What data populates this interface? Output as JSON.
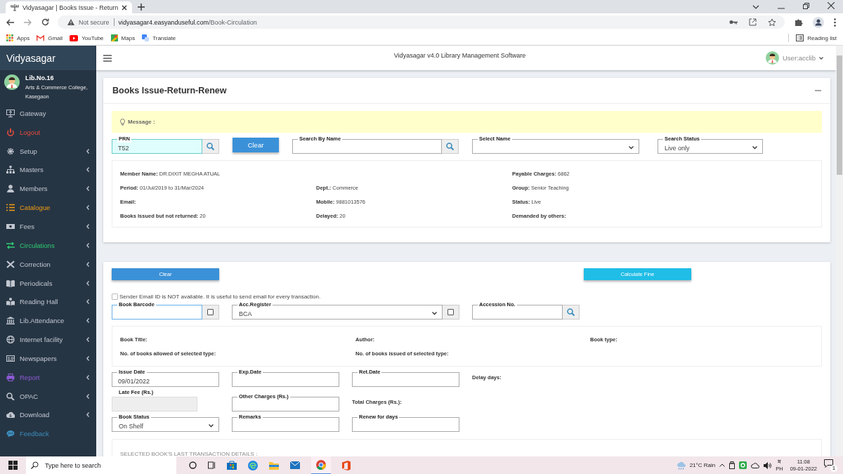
{
  "browser": {
    "tab_title": "Vidyasagar | Books Issue - Return",
    "security": "Not secure",
    "url_host": "vidyasagar4.easyanduseful.com",
    "url_path": "/Book-Circulation",
    "bookmarks": [
      "Apps",
      "Gmail",
      "YouTube",
      "Maps",
      "Translate"
    ],
    "reading_list": "Reading list"
  },
  "app": {
    "brand": "Vidyasagar",
    "lib_no": "Lib.No.16",
    "college": "Arts & Commerce College, Kasegaon",
    "header_title": "Vidyasagar v4.0 Library Management Software",
    "user": "User:acclib",
    "menu": [
      {
        "label": "Gateway",
        "color": "#c2c7d0",
        "has_submenu": false
      },
      {
        "label": "Logout",
        "color": "#e74c3c",
        "has_submenu": false
      },
      {
        "label": "Setup",
        "color": "#c2c7d0",
        "has_submenu": true
      },
      {
        "label": "Masters",
        "color": "#c2c7d0",
        "has_submenu": true
      },
      {
        "label": "Members",
        "color": "#c2c7d0",
        "has_submenu": true
      },
      {
        "label": "Catalogue",
        "color": "#f39c12",
        "has_submenu": true
      },
      {
        "label": "Fees",
        "color": "#c2c7d0",
        "has_submenu": true
      },
      {
        "label": "Circulations",
        "color": "#2ecc71",
        "has_submenu": true
      },
      {
        "label": "Correction",
        "color": "#c2c7d0",
        "has_submenu": true
      },
      {
        "label": "Periodicals",
        "color": "#c2c7d0",
        "has_submenu": true
      },
      {
        "label": "Reading Hall",
        "color": "#c2c7d0",
        "has_submenu": true
      },
      {
        "label": "Lib.Attendance",
        "color": "#c2c7d0",
        "has_submenu": true
      },
      {
        "label": "Internet facility",
        "color": "#c2c7d0",
        "has_submenu": true
      },
      {
        "label": "Newspapers",
        "color": "#c2c7d0",
        "has_submenu": true
      },
      {
        "label": "Report",
        "color": "#8e5bd6",
        "has_submenu": true
      },
      {
        "label": "OPAC",
        "color": "#c2c7d0",
        "has_submenu": true
      },
      {
        "label": "Download",
        "color": "#c2c7d0",
        "has_submenu": true
      },
      {
        "label": "Feedback",
        "color": "#3c8dbc",
        "has_submenu": false
      }
    ]
  },
  "issue_panel": {
    "title": "Books Issue-Return-Renew",
    "message_label": "Message :",
    "prn": {
      "label": "PRN",
      "value": "T52"
    },
    "clear_button": "Clear",
    "search_by_name": {
      "label": "Search By Name"
    },
    "select_name": {
      "label": "Select Name"
    },
    "search_status": {
      "label": "Search Status",
      "value": "Live only"
    },
    "member_rows": [
      [
        {
          "label": "Member Name:",
          "value": "DR.DIXIT MEGHA ATUAL"
        },
        null,
        {
          "label": "Payable Charges:",
          "value": "6862"
        }
      ],
      [
        {
          "label": "Period:",
          "value": "01/Jul/2019 to  31/Mar/2024"
        },
        {
          "label": "Dept.:",
          "value": "Commerce"
        },
        {
          "label": "Group:",
          "value": "Senior Teaching"
        }
      ],
      [
        {
          "label": "Email:"
        },
        {
          "label": "Mobile:",
          "value": "9881013576"
        },
        {
          "label": "Status:",
          "value": "Live"
        }
      ],
      [
        {
          "label": "Books Issued but not returned:",
          "value": "20"
        },
        {
          "label": "Delayed:",
          "value": "20"
        },
        {
          "label": "Demanded by others:"
        }
      ]
    ]
  },
  "book_panel": {
    "clear_button": "Clear",
    "calculate_button": "Calculate Fine",
    "email_notice": {
      "text": "Sender Email ID is NOT available. It is useful to send email for every transaction.",
      "checked": false
    },
    "book_barcode": {
      "label": "Book Barcode",
      "checked": false
    },
    "acc_register": {
      "label": "Acc.Register",
      "value": "BCA",
      "checked": false
    },
    "accession_no": {
      "label": "Accession No."
    },
    "book_rows": [
      [
        {
          "label": "Book Title:"
        },
        {
          "label": "Author:"
        },
        {
          "label": "Book type:"
        }
      ],
      [
        {
          "label": "No. of books allowed of selected type:"
        },
        {
          "label": "No. of books issued of selected type:"
        },
        null
      ]
    ],
    "charges_rows": [
      [
        {
          "kind": "input",
          "label": "Issue Date",
          "value": "09/01/2022",
          "disabled": false
        },
        {
          "kind": "input",
          "label": "Exp.Date",
          "disabled": false
        },
        {
          "kind": "input",
          "label": "Ret.Date",
          "disabled": false
        },
        {
          "kind": "text",
          "label": "Delay days:"
        }
      ],
      [
        {
          "kind": "input",
          "label": "Late Fee (Rs.)",
          "disabled": true
        },
        {
          "kind": "input",
          "label": "Other Charges (Rs.)",
          "disabled": false
        },
        {
          "kind": "text",
          "label": "Total Charges (Rs.):"
        }
      ],
      [
        {
          "kind": "select",
          "label": "Book Status",
          "value": "On Shelf",
          "disabled": false
        },
        {
          "kind": "input",
          "label": "Remarks",
          "disabled": false
        },
        {
          "kind": "input",
          "label": "Renew for days",
          "disabled": false
        }
      ]
    ],
    "last_transaction": {
      "label": "SELECTED BOOK'S LAST TRANSACTION DETAILS",
      "suffix": ":"
    }
  },
  "taskbar": {
    "search_placeholder": "Type here to search",
    "weather": "21°C Rain",
    "language": "म",
    "language_sub": "PH",
    "time": "11:08",
    "date": "09-01-2022",
    "notification_count": "1"
  }
}
